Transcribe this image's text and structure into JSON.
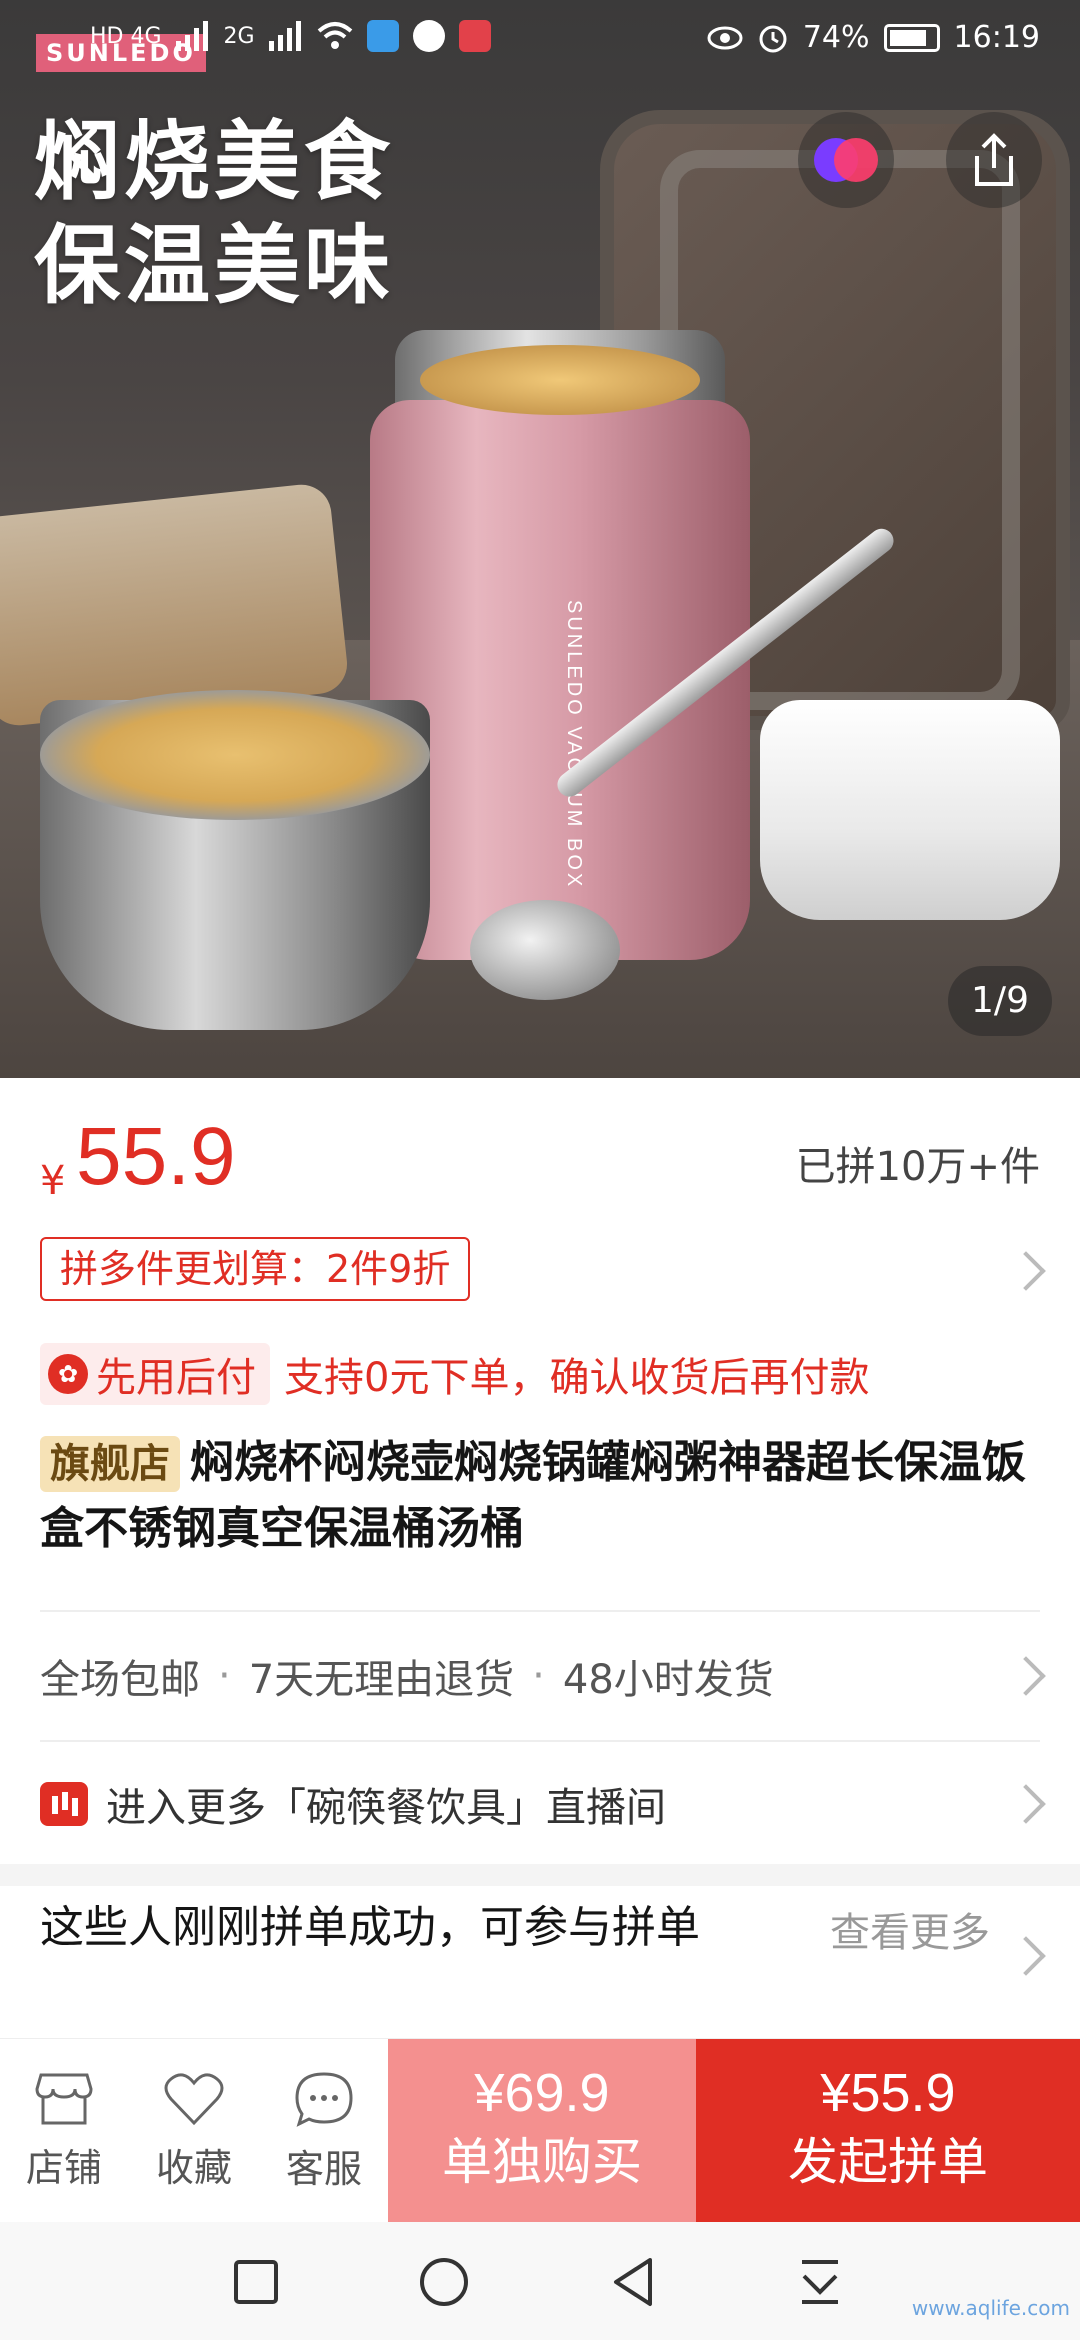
{
  "status_bar": {
    "network_left": "HD 4G",
    "network_right": "2G",
    "battery": "74%",
    "time": "16:19"
  },
  "hero": {
    "brand_logo": "SUNLEDO",
    "headline_line1": "焖烧美食",
    "headline_line2": "保温美味",
    "jar_label": "SUNLEDO VACUUM BOX",
    "image_counter": "1/9"
  },
  "product": {
    "price_symbol": "¥",
    "price": "55.9",
    "sold": "已拼10万+件",
    "promo": "拼多件更划算：2件9折",
    "paylater_label": "先用后付",
    "paylater_desc": "支持0元下单，确认收货后再付款",
    "flagship_badge": "旗舰店",
    "title": "焖烧杯闷烧壶焖烧锅罐焖粥神器超长保温饭盒不锈钢真空保温桶汤桶"
  },
  "services": {
    "items": [
      "全场包邮",
      "7天无理由退货",
      "48小时发货"
    ],
    "separator": "·"
  },
  "live": {
    "text": "进入更多「碗筷餐饮具」直播间"
  },
  "group_buy": {
    "title": "这些人刚刚拼单成功，可参与拼单",
    "more": "查看更多"
  },
  "action_bar": {
    "store": "店铺",
    "favorite": "收藏",
    "service": "客服",
    "alone_price": "¥69.9",
    "alone_label": "单独购买",
    "group_price": "¥55.9",
    "group_label": "发起拼单"
  },
  "watermark": "www.aqlife.com",
  "colors": {
    "accent_red": "#e02e24",
    "alone_pink": "#f4908f",
    "badge_gold": "#f6e2b6"
  }
}
